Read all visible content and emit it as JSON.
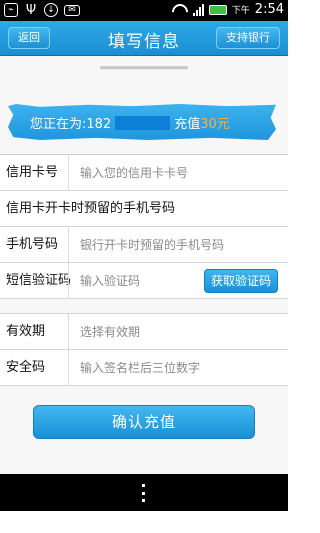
{
  "status_bar": {
    "icons": [
      "usb-icon",
      "antenna-icon",
      "download-icon",
      "mail-icon",
      "wifi-icon",
      "signal-icon",
      "battery-icon"
    ],
    "ampm": "下午",
    "time": "2:54"
  },
  "header": {
    "back_label": "返回",
    "title": "填写信息",
    "bank_label": "支持银行"
  },
  "banner": {
    "prefix": "您正在为:182",
    "recharge_label": "充值",
    "amount": "30元"
  },
  "form": {
    "card_label": "信用卡号",
    "card_placeholder": "输入您的信用卡卡号",
    "reserved_phone_title": "信用卡开卡时预留的手机号码",
    "phone_label": "手机号码",
    "phone_placeholder": "银行开卡时预留的手机号码",
    "sms_label": "短信验证码",
    "sms_placeholder": "输入验证码",
    "get_code_label": "获取验证码",
    "expiry_label": "有效期",
    "expiry_placeholder": "选择有效期",
    "cvv_label": "安全码",
    "cvv_placeholder": "输入签名栏后三位数字"
  },
  "confirm_label": "确认充值",
  "colors": {
    "accent": "#1a8ed3",
    "amount": "#ffb236"
  }
}
